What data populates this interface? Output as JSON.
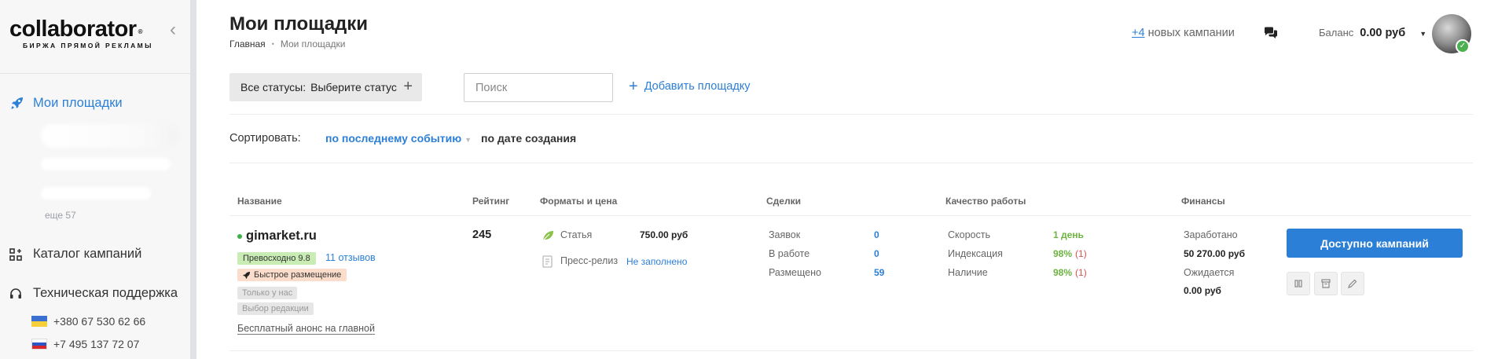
{
  "sidebar": {
    "logo": "collaborator",
    "logo_reg": "®",
    "logo_sub": "БИРЖА ПРЯМОЙ РЕКЛАМЫ",
    "collapse": "‹",
    "main_item": "Мои площадки",
    "more": "еще 57",
    "catalog": "Каталог кампаний",
    "support": "Техническая поддержка",
    "phones": [
      "+380 67 530 62 66",
      "+7 495 137 72 07"
    ]
  },
  "header": {
    "title": "Мои площадки",
    "breadcrumb": [
      "Главная",
      "•",
      "Мои площадки"
    ],
    "new_campaigns_count": "+4",
    "new_campaigns_text": "новых кампании",
    "balance_label": "Баланс",
    "balance_value": "0.00 руб",
    "avatar_status": "✓"
  },
  "toolbar": {
    "status_label": "Все статусы:",
    "status_value": "Выберите статус",
    "status_plus": "+",
    "search_placeholder": "Поиск",
    "add_site": "Добавить площадку",
    "add_plus": "+"
  },
  "sort": {
    "label": "Сортировать:",
    "option1": "по последнему событию",
    "option2": "по дате создания"
  },
  "table": {
    "headers": [
      "Название",
      "Рейтинг",
      "Форматы и цена",
      "Сделки",
      "Качество работы",
      "Финансы"
    ],
    "row": {
      "site": "gimarket.ru",
      "rating_badge": "Превосходно 9.8",
      "reviews": "11 отзывов",
      "fast_badge": "Быстрое размещение",
      "badge_only": "Только у нас",
      "badge_editor": "Выбор редакции",
      "free_anons": "Бесплатный анонс на главной",
      "rating": "245",
      "formats": [
        {
          "label": "Статья",
          "price": "750.00 руб"
        },
        {
          "label": "Пресс-релиз",
          "price": "Не заполнено"
        }
      ],
      "deals": [
        {
          "label": "Заявок",
          "value": "0"
        },
        {
          "label": "В работе",
          "value": "0"
        },
        {
          "label": "Размещено",
          "value": "59"
        }
      ],
      "quality": [
        {
          "label": "Скорость",
          "value": "1 день",
          "extra": ""
        },
        {
          "label": "Индексация",
          "value": "98%",
          "extra": "(1)"
        },
        {
          "label": "Наличие",
          "value": "98%",
          "extra": "(1)"
        }
      ],
      "finance": {
        "earned_label": "Заработано",
        "earned_value": "50 270.00 руб",
        "pending_label": "Ожидается",
        "pending_value": "0.00 руб"
      },
      "cta": "Доступно кампаний"
    }
  },
  "colors": {
    "accent": "#2c7fd6",
    "green": "#6cb33f",
    "red": "#d9534f"
  }
}
